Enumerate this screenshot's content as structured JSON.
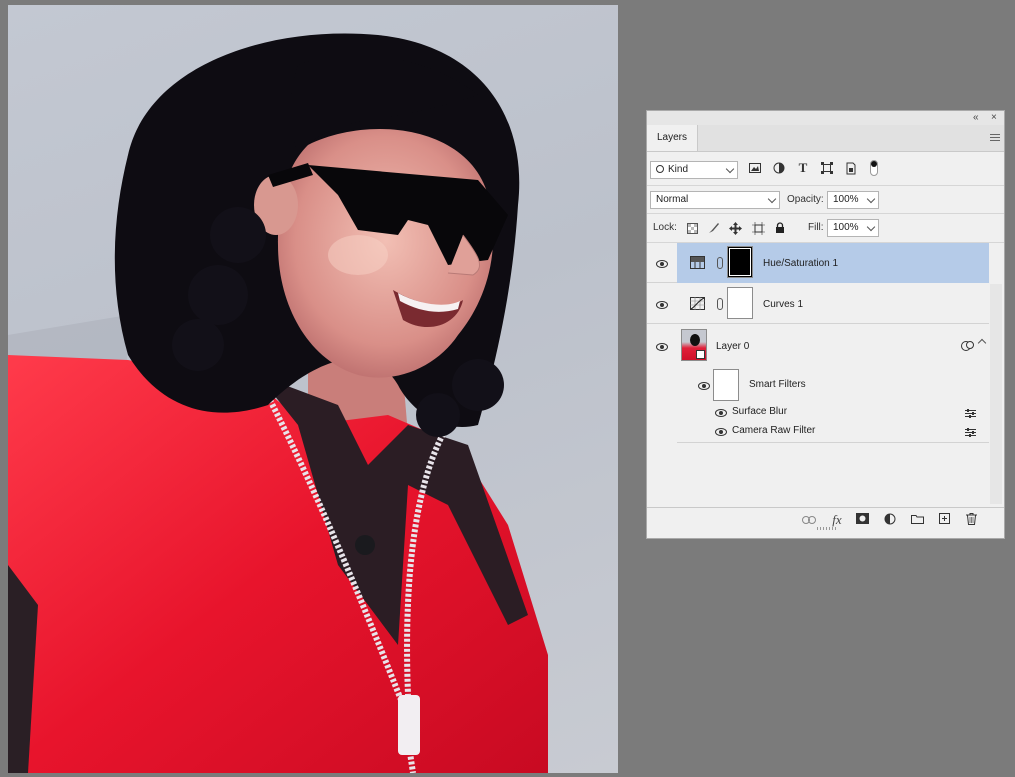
{
  "canvas": {
    "subject": "photo"
  },
  "panel": {
    "tab_label": "Layers",
    "collapse_glyph": "«",
    "close_glyph": "×",
    "filter": {
      "kind_label": "Kind",
      "icons": [
        "image-filter-icon",
        "adjustment-filter-icon",
        "type-filter-icon",
        "shape-filter-icon",
        "smart-object-filter-icon",
        "filter-toggle-icon"
      ]
    },
    "blend_mode": "Normal",
    "opacity_label": "Opacity:",
    "opacity_value": "100%",
    "lock_label": "Lock:",
    "fill_label": "Fill:",
    "fill_value": "100%",
    "layers": [
      {
        "name": "Hue/Saturation 1",
        "selected": true
      },
      {
        "name": "Curves 1",
        "selected": false
      },
      {
        "name": "Layer 0",
        "selected": false
      }
    ],
    "smart_filters_label": "Smart Filters",
    "filters": [
      {
        "name": "Surface Blur"
      },
      {
        "name": "Camera Raw Filter"
      }
    ],
    "bottom_buttons": [
      "link-icon",
      "fx-icon",
      "mask-icon",
      "adjustment-icon",
      "folder-icon",
      "new-layer-icon",
      "trash-icon"
    ],
    "fx_label": "fx",
    "colors": {
      "selection": "#b5cbe8",
      "panel": "#f0f0f0",
      "workspace": "#7b7b7b"
    }
  }
}
